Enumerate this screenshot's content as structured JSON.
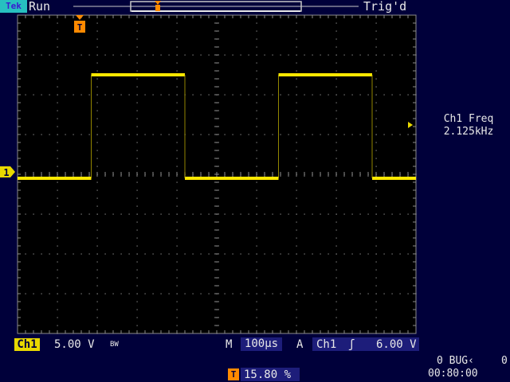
{
  "header": {
    "brand": "Tek",
    "acq_state": "Run",
    "trigger_status": "Trig'd"
  },
  "measurement": {
    "label": "Ch1 Freq",
    "value": "2.125kHz"
  },
  "channel": {
    "marker": "1",
    "badge": "Ch1",
    "scale": "5.00 V",
    "bandwidth_mark": "BW"
  },
  "timebase": {
    "label": "M",
    "value": "100µs"
  },
  "trigger": {
    "label": "A",
    "source": "Ch1",
    "slope": "ʃ",
    "level": "6.00 V",
    "marker": "T"
  },
  "trigger_position": {
    "value": "15.80 %",
    "icon": "T"
  },
  "status": {
    "counter": "0 BUG‹",
    "counter_extra": "0",
    "clock": "00:80:00"
  },
  "colors": {
    "background": "#00003a",
    "trace": "#ffe800",
    "trigger_marker": "#ff8a00",
    "graticule": "#8c8c8c"
  },
  "waveform": {
    "type": "square",
    "low_level_div": -0.1,
    "high_level_div": 2.5,
    "edges_div": [
      -3.15,
      -0.8,
      1.55,
      3.9
    ],
    "x_range_div": [
      -5,
      5
    ],
    "y_range_div": [
      -4,
      4
    ],
    "start_level": "low"
  }
}
